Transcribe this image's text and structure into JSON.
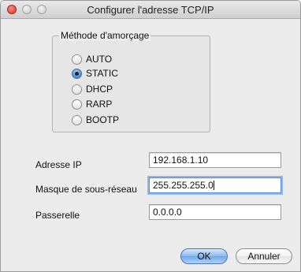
{
  "window": {
    "title": "Configurer l'adresse TCP/IP"
  },
  "boot_method": {
    "title": "Méthode d'amorçage",
    "options": [
      {
        "label": "AUTO",
        "checked": false
      },
      {
        "label": "STATIC",
        "checked": true
      },
      {
        "label": "DHCP",
        "checked": false
      },
      {
        "label": "RARP",
        "checked": false
      },
      {
        "label": "BOOTP",
        "checked": false
      }
    ]
  },
  "fields": {
    "ip": {
      "label": "Adresse IP",
      "value": "192.168.1.10"
    },
    "mask": {
      "label": "Masque de sous-réseau",
      "value": "255.255.255.0"
    },
    "gateway": {
      "label": "Passerelle",
      "value": "0.0.0.0"
    }
  },
  "buttons": {
    "ok": "OK",
    "cancel": "Annuler"
  }
}
